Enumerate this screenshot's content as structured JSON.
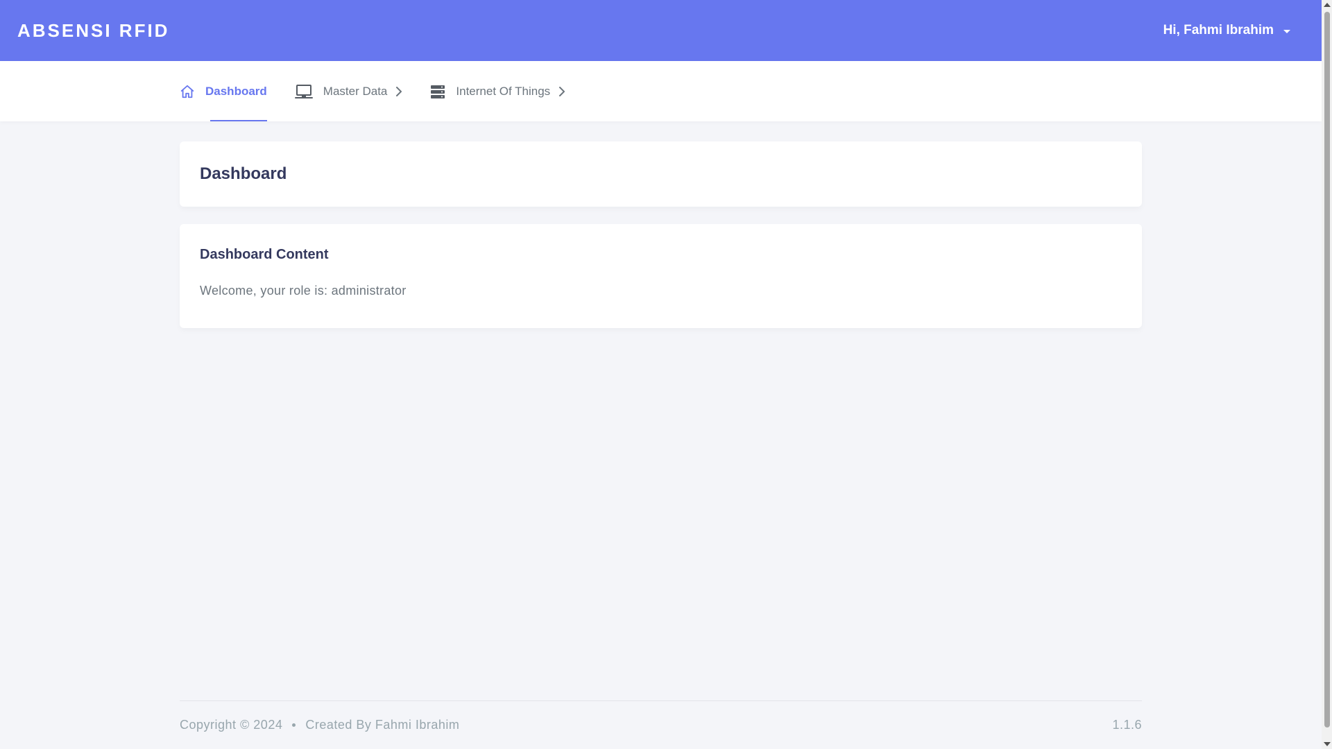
{
  "app": {
    "brand": "ABSENSI RFID"
  },
  "header": {
    "greeting": "Hi, Fahmi Ibrahim"
  },
  "nav": {
    "items": [
      {
        "label": "Dashboard",
        "icon": "home-icon",
        "active": true
      },
      {
        "label": "Master Data",
        "icon": "monitor-icon",
        "has_submenu": true
      },
      {
        "label": "Internet Of Things",
        "icon": "server-icon",
        "has_submenu": true
      }
    ]
  },
  "page": {
    "title": "Dashboard",
    "card_title": "Dashboard Content",
    "welcome_text": "Welcome, your role is: administrator"
  },
  "footer": {
    "copyright": "Copyright © 2024",
    "created_by": "Created By Fahmi Ibrahim",
    "version": "1.1.6"
  },
  "colors": {
    "primary": "#6777ef",
    "background": "#f4f5f9",
    "heading": "#34395e",
    "muted": "#6c757d"
  }
}
